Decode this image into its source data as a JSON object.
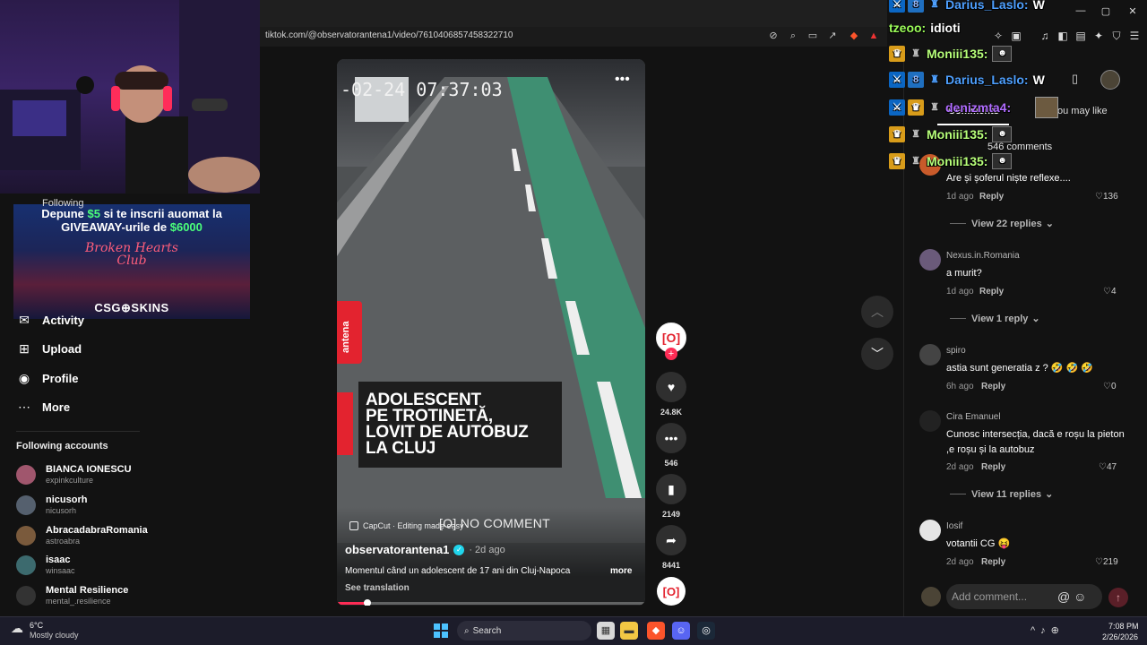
{
  "browser": {
    "url": "tiktok.com/@observatorantena1/video/7610406857458322710",
    "window_controls": [
      "—",
      "▢",
      "✕"
    ]
  },
  "ad_banner": {
    "line1_prefix": "Depune ",
    "line1_amount": "$5",
    "line1_suffix": " si te inscrii auomat la",
    "line2_prefix": "GIVEAWAY-urile de ",
    "line2_amount": "$6000",
    "club": "Broken Hearts Club",
    "brand": "CSG⊕SKINS"
  },
  "sidebar": {
    "following_partial": "Following",
    "nav": [
      {
        "label": "Activity",
        "icon": "bell-icon",
        "glyph": "✉"
      },
      {
        "label": "Upload",
        "icon": "upload-icon",
        "glyph": "⊞"
      },
      {
        "label": "Profile",
        "icon": "profile-icon",
        "glyph": "◉"
      },
      {
        "label": "More",
        "icon": "more-icon",
        "glyph": "⋯"
      }
    ],
    "following_title": "Following accounts",
    "accounts": [
      {
        "name": "BIANCA IONESCU",
        "handle": "expinkculture",
        "color": "#a0566d"
      },
      {
        "name": "nicusorh",
        "handle": "nicusorh",
        "color": "#55606e"
      },
      {
        "name": "AbracadabraRomania",
        "handle": "astroabra",
        "color": "#7a5a3c"
      },
      {
        "name": "isaac",
        "handle": "winsaac",
        "color": "#3c6a6e"
      },
      {
        "name": "Mental Resilience",
        "handle": "mental_.resilience",
        "color": "#333333"
      }
    ]
  },
  "video": {
    "timestamp": "-02-24 07:37:03",
    "channel_tab": "antena",
    "headline": [
      "ADOLESCENT",
      "PE TROTINETĂ,",
      "LOVIT DE AUTOBUZ",
      "LA CLUJ"
    ],
    "no_comment": "[O] NO COMMENT",
    "capcut": "CapCut · Editing made easy",
    "author": "observatorantena1",
    "post_time": "· 2d ago",
    "description": "Momentul când un adolescent de 17 ani din Cluj-Napoca",
    "more": "more",
    "see_translation": "See translation",
    "progress": 0.1
  },
  "rail": {
    "avatar_text": "[O]",
    "likes": "24.8K",
    "comments": "546",
    "saves": "2149",
    "shares": "8441"
  },
  "comments_panel": {
    "tab_comments": "Comments",
    "tab_you_may_like": "ou may like",
    "count": "546 comments",
    "add_placeholder": "Add comment...",
    "items": [
      {
        "user": "",
        "text": "Are și șoferul niște reflexe....",
        "time": "1d ago",
        "reply": "Reply",
        "likes": "136",
        "view": "View 22 replies",
        "color": "#c85a2a"
      },
      {
        "user": "Nexus.in.Romania",
        "text": "a murit?",
        "time": "1d ago",
        "reply": "Reply",
        "likes": "4",
        "view": "View 1 reply",
        "color": "#6a5a7a"
      },
      {
        "user": "spiro",
        "text": "astia sunt generatia z ? 🤣 🤣 🤣",
        "time": "6h ago",
        "reply": "Reply",
        "likes": "0",
        "view": "",
        "color": "#444444"
      },
      {
        "user": "Cira Emanuel",
        "text": "Cunosc intersecția, dacă e roșu la pieton ,e roșu și la autobuz",
        "time": "2d ago",
        "reply": "Reply",
        "likes": "47",
        "view": "View 11 replies",
        "color": "#222222"
      },
      {
        "user": "Iosif",
        "text": "votantii CG 😝",
        "time": "2d ago",
        "reply": "Reply",
        "likes": "219",
        "view": "",
        "color": "#e5e5e5"
      }
    ]
  },
  "chat": [
    {
      "user": "Darius_Laslo:",
      "msg": "W",
      "color": "#4ea0ff",
      "badges": [
        "b-blue",
        "b-green"
      ]
    },
    {
      "user": "tzeoo:",
      "msg": "idioti",
      "color": "#9dff5a",
      "badges": []
    },
    {
      "user": "Moniii135:",
      "msg": "",
      "color": "#b7ff7a",
      "badges": [
        "b-gold"
      ]
    },
    {
      "user": "Darius_Laslo:",
      "msg": "W",
      "color": "#4ea0ff",
      "badges": [
        "b-blue",
        "b-green"
      ]
    },
    {
      "user": "denizmta4:",
      "msg": "",
      "color": "#b06cff",
      "badges": [
        "b-blue",
        "b-gold"
      ]
    },
    {
      "user": "Moniii135:",
      "msg": "",
      "color": "#b7ff7a",
      "badges": [
        "b-gold"
      ]
    },
    {
      "user": "Moniii135:",
      "msg": "",
      "color": "#b7ff7a",
      "badges": [
        "b-gold"
      ]
    }
  ],
  "taskbar": {
    "temp": "6°C",
    "weather": "Mostly cloudy",
    "search": "Search",
    "time": "7:08 PM",
    "date": "2/26/2026"
  }
}
